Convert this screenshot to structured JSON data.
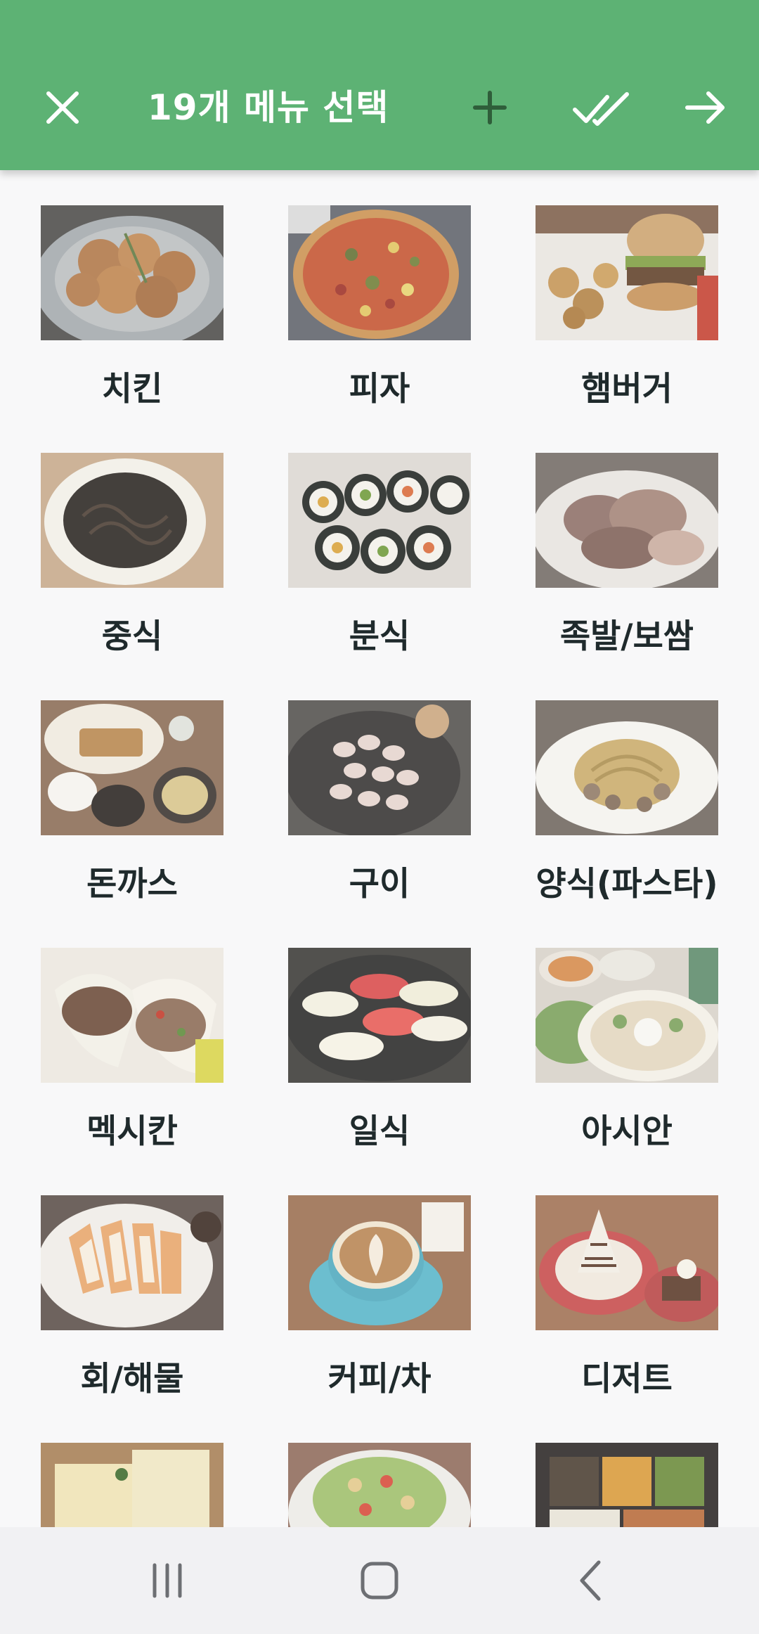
{
  "appbar": {
    "title": "19개 메뉴 선택",
    "background": "#5db274",
    "icons": {
      "close": "close-icon",
      "add": "add-icon",
      "select_all": "double-check-icon",
      "next": "arrow-right-icon"
    }
  },
  "menu_items": [
    {
      "label": "치킨",
      "image": "fried-chicken-photo"
    },
    {
      "label": "피자",
      "image": "pizza-photo"
    },
    {
      "label": "햄버거",
      "image": "burger-photo"
    },
    {
      "label": "중식",
      "image": "jajangmyeon-photo"
    },
    {
      "label": "분식",
      "image": "kimbap-photo"
    },
    {
      "label": "족발/보쌈",
      "image": "jokbal-photo"
    },
    {
      "label": "돈까스",
      "image": "tonkatsu-photo"
    },
    {
      "label": "구이",
      "image": "grill-photo"
    },
    {
      "label": "양식(파스타)",
      "image": "pasta-photo"
    },
    {
      "label": "멕시칸",
      "image": "tacos-photo"
    },
    {
      "label": "일식",
      "image": "sushi-photo"
    },
    {
      "label": "아시안",
      "image": "pho-photo"
    },
    {
      "label": "회/해물",
      "image": "sashimi-photo"
    },
    {
      "label": "커피/차",
      "image": "latte-photo"
    },
    {
      "label": "디저트",
      "image": "dessert-photo"
    },
    {
      "label": "",
      "image": "sandwich-photo"
    },
    {
      "label": "",
      "image": "salad-photo"
    },
    {
      "label": "",
      "image": "lunchbox-photo"
    }
  ],
  "navbar": {
    "recent": "recent-apps-icon",
    "home": "home-icon",
    "back": "back-icon"
  }
}
